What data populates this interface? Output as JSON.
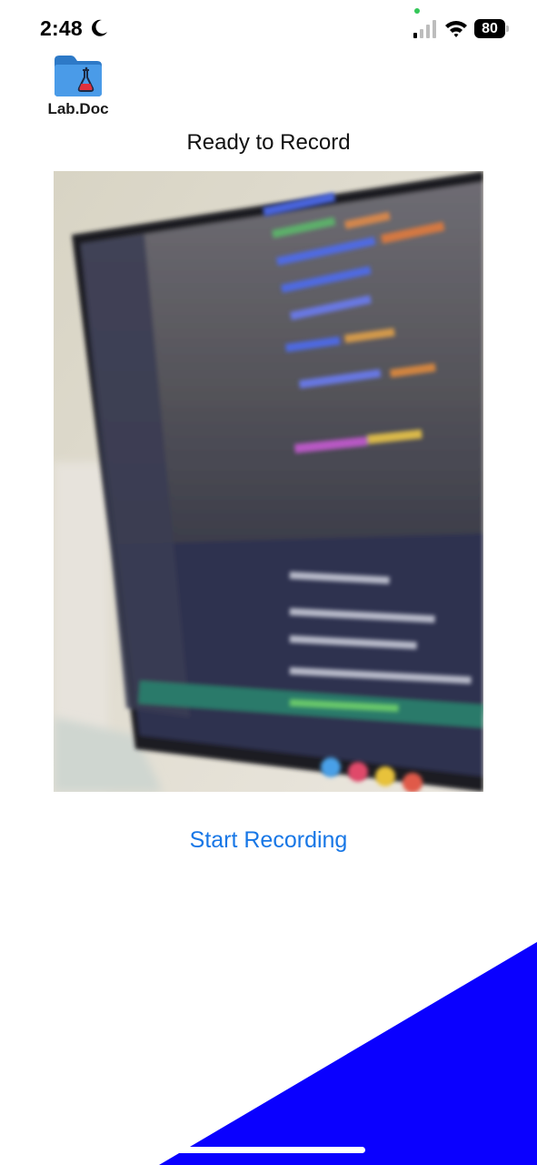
{
  "status_bar": {
    "time": "2:48",
    "battery_percent": "80",
    "icons": [
      "moon-icon",
      "cellular-signal-icon",
      "wifi-icon",
      "battery-icon"
    ]
  },
  "app": {
    "logo_text": "Lab.Doc",
    "logo_icon": "folder-flask-icon"
  },
  "screen": {
    "title": "Ready to Record",
    "record_button_label": "Start Recording"
  },
  "colors": {
    "accent": "#1877e6",
    "corner_shape": "#0a00ff",
    "logo_folder": "#3b8fe0"
  }
}
